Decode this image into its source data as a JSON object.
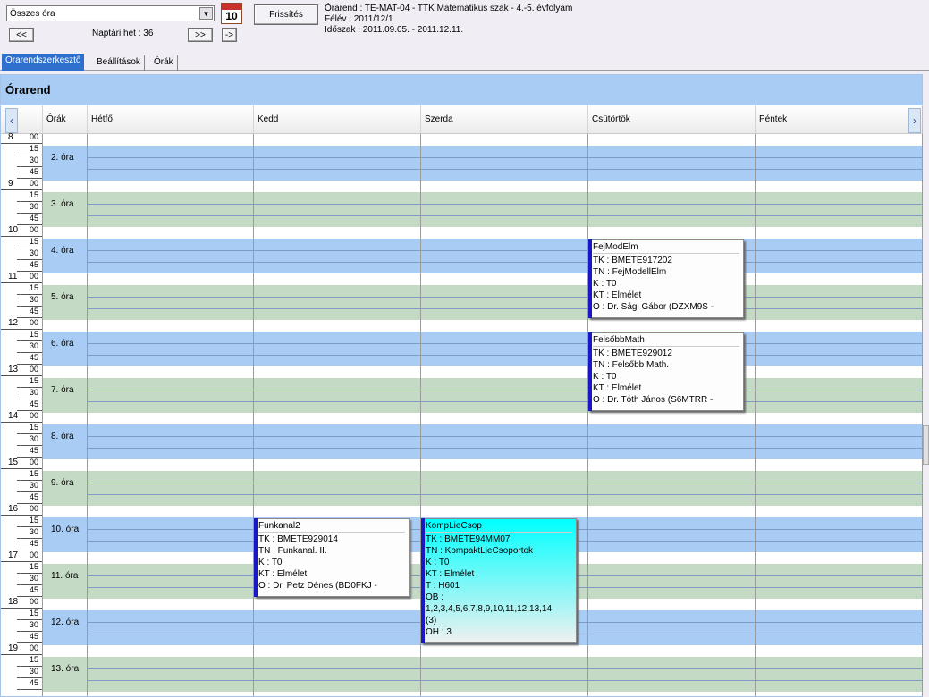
{
  "toolbar": {
    "filter_value": "Összes óra",
    "refresh_label": "Frissítés",
    "calendar_day": "10",
    "prev_label": "<<",
    "next_label": ">>",
    "jump_label": "->",
    "week_label": "Naptári hét : 36"
  },
  "info": {
    "line1": "Órarend : TE-MAT-04 - TTK Matematikus szak - 4.-5. évfolyam",
    "line2": "Félév : 2011/12/1",
    "line3": "Időszak : 2011.09.05. - 2011.12.11."
  },
  "tabs": [
    "Órarendszerkesztő",
    "Beállítások",
    "Órák"
  ],
  "panel": {
    "title": "Órarend",
    "hours_header": "Órák",
    "days": [
      "Hétfő",
      "Kedd",
      "Szerda",
      "Csütörtök",
      "Péntek"
    ]
  },
  "hours": [
    "8",
    "9",
    "10",
    "11",
    "12",
    "13",
    "14",
    "15",
    "16",
    "17",
    "18",
    "19"
  ],
  "minutes": [
    "00",
    "15",
    "30",
    "45"
  ],
  "slots": [
    "2. óra",
    "3. óra",
    "4. óra",
    "5. óra",
    "6. óra",
    "7. óra",
    "8. óra",
    "9. óra",
    "10. óra",
    "11. óra",
    "12. óra",
    "13. óra"
  ],
  "events": [
    {
      "title": "FejModElm",
      "lines": [
        "TK : BMETE917202",
        "TN : FejModellElm",
        "K : T0",
        "KT : Elmélet",
        "O :  Dr. Sági Gábor (DZXM9S -"
      ]
    },
    {
      "title": "FelsőbbMath",
      "lines": [
        "TK : BMETE929012",
        "TN : Felsőbb Math.",
        "K : T0",
        "KT : Elmélet",
        "O :  Dr. Tóth János (S6MTRR -"
      ]
    },
    {
      "title": "Funkanal2",
      "lines": [
        "TK : BMETE929014",
        "TN : Funkanal. II.",
        "K : T0",
        "KT : Elmélet",
        "O :  Dr. Petz Dénes (BD0FKJ -"
      ]
    },
    {
      "title": "KompLieCsop",
      "lines": [
        "TK : BMETE94MM07",
        "TN : KompaktLieCsoportok",
        "K : T0",
        "KT : Elmélet",
        "T : H601",
        "OB :",
        "1,2,3,4,5,6,7,8,9,10,11,12,13,14",
        "(3)",
        "OH : 3"
      ]
    }
  ],
  "colors": {
    "blue_slot": "#a8ccf4",
    "green_slot": "#c4dac4",
    "accent": "#1a18c6",
    "cyan": "#00ffff"
  }
}
